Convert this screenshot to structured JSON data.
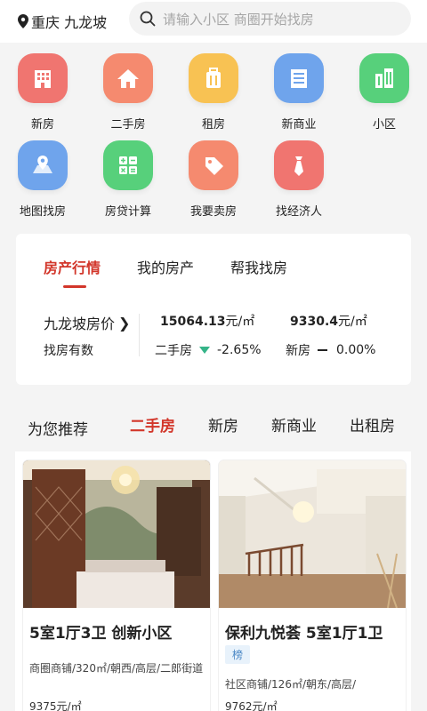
{
  "header": {
    "location": "重庆 九龙坡",
    "search_placeholder": "请输入小区 商圈开始找房"
  },
  "grid": [
    {
      "label": "新房",
      "icon": "building-icon",
      "color": "#f07570"
    },
    {
      "label": "二手房",
      "icon": "house-icon",
      "color": "#f58a6f"
    },
    {
      "label": "租房",
      "icon": "suitcase-icon",
      "color": "#f8c253"
    },
    {
      "label": "新商业",
      "icon": "office-icon",
      "color": "#6fa4ec"
    },
    {
      "label": "小区",
      "icon": "community-icon",
      "color": "#57d07b"
    },
    {
      "label": "地图找房",
      "icon": "map-pin-icon",
      "color": "#6fa4ec"
    },
    {
      "label": "房贷计算",
      "icon": "calculator-icon",
      "color": "#57d07b"
    },
    {
      "label": "我要卖房",
      "icon": "tag-icon",
      "color": "#f58a6f"
    },
    {
      "label": "找经济人",
      "icon": "agent-tie-icon",
      "color": "#f07570"
    }
  ],
  "market": {
    "tabs": [
      "房产行情",
      "我的房产",
      "帮我找房"
    ],
    "area_price_label": "九龙坡房价",
    "chevron": "❯",
    "find_label": "找房有数",
    "price1_value": "15064.13",
    "price1_unit": "元/㎡",
    "price2_value": "9330.4",
    "price2_unit": "元/㎡",
    "chg1_label": "二手房",
    "chg1_value": "-2.65%",
    "chg2_label": "新房",
    "chg2_value": "0.00%",
    "down_color": "#35b488"
  },
  "recommend": {
    "title": "为您推荐",
    "tabs": [
      "二手房",
      "新房",
      "新商业",
      "出租房"
    ]
  },
  "listings": [
    {
      "title": "5室1厅3卫 创新小区",
      "desc": "商圈商铺/320㎡/朝西/高层/二郎街道",
      "price": "9375元/㎡"
    },
    {
      "title": "保利九悦荟 5室1厅1卫",
      "tag": "榜",
      "desc": "社区商铺/126㎡/朝东/高层/",
      "price": "9762元/㎡"
    }
  ],
  "colors": {
    "accent": "#d2362a"
  }
}
